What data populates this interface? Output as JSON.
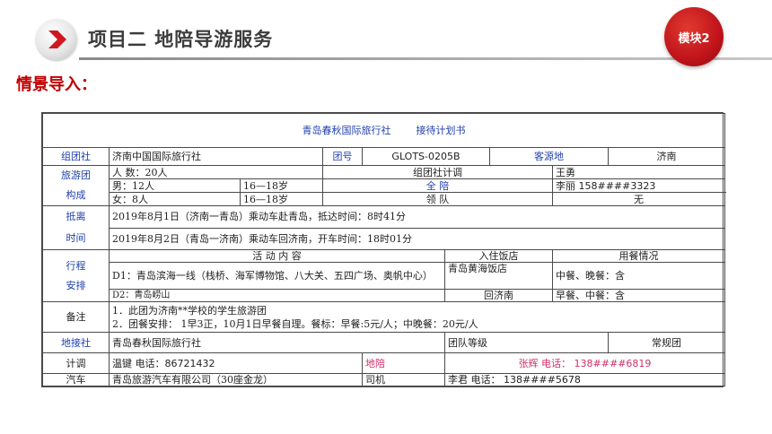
{
  "header": {
    "title": "项目二  地陪导游服务",
    "module_badge": "模块2",
    "section_title": "情景导入："
  },
  "doc": {
    "agency_title": "青岛春秋国际旅行社",
    "plan_title": "接待计划书",
    "org_label": "组团社",
    "org_value": "济南中国国际旅行社",
    "group_no_label": "团号",
    "group_no_value": "GLOTS-0205B",
    "source_label": "客源地",
    "source_value": "济南",
    "tour_group_label_1": "旅游团",
    "tour_group_label_2": "构成",
    "people_count": "人    数：20人",
    "org_dispatcher_label": "组团社计调",
    "org_dispatcher_value": "王勇",
    "male": "男：12人",
    "male_age": "16—18岁",
    "national_guide_label": "全      陪",
    "national_guide_value": "李丽   158####3323",
    "female": "女：8人",
    "female_age": "16—18岁",
    "leader_label": "领        队",
    "leader_value": "无",
    "arrive_label_1": "抵离",
    "arrive_label_2": "时间",
    "arrival": "2019年8月1日（济南一青岛）乘动车赴青岛，抵达时间：8时41分",
    "departure": "2019年8月2日（青岛一济南）乘动车回济南，开车时间：18时01分",
    "itinerary_label_1": "行程",
    "itinerary_label_2": "安排",
    "activity_header": "活  动  内  容",
    "hotel_header": "入住饭店",
    "meal_header": "用餐情况",
    "d1_activity": "D1：青岛滨海一线（栈桥、海军博物馆、八大关、五四广场、奥帆中心）",
    "d1_hotel": "青岛黄海饭店",
    "d1_meal": "中餐、晚餐：含",
    "d2_activity": "D2：青岛崂山",
    "d2_hotel": "回济南",
    "d2_meal": "早餐、中餐：含",
    "remarks_label": "备注",
    "remark_1": "1．此团为济南**学校的学生旅游团",
    "remark_2": "2．团餐安排：  1早3正，10月1日早餐自理。餐标：早餐:5元/人；中晚餐：20元/人",
    "receiving_label": "地接社",
    "receiving_value": "青岛春秋国际旅行社",
    "group_level_label": "团队等级",
    "group_level_value": "常规团",
    "dispatcher_label": "计调",
    "dispatcher_value": "温键  电话：86721432",
    "local_guide_label": "地陪",
    "local_guide_value": "张辉  电话： 138####6819",
    "bus_label": "汽车",
    "bus_value": "青岛旅游汽车有限公司（30座金龙）",
    "driver_label": "司机",
    "driver_value": "李君  电话： 138####5678"
  },
  "colors": {
    "accent_red": "#c00000",
    "badge_red": "#c0131b",
    "label_blue": "#1f3fae",
    "guide_pink": "#d0306a"
  }
}
